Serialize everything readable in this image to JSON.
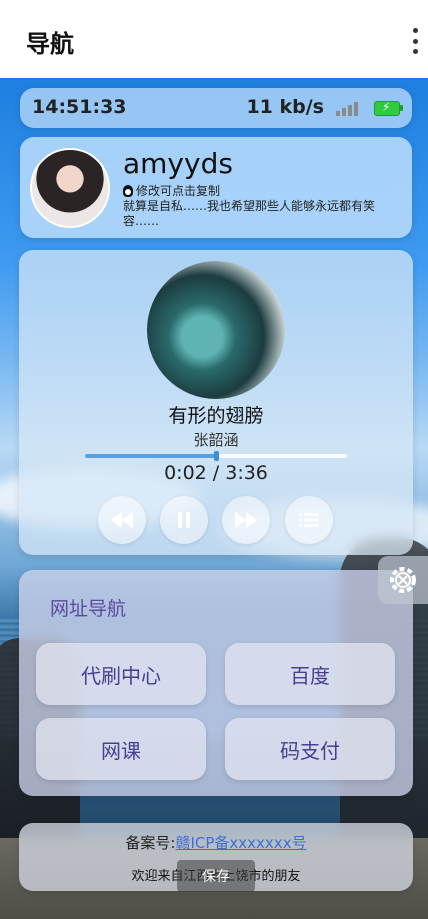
{
  "appbar": {
    "title": "导航",
    "more_icon": "more-vertical-icon"
  },
  "status": {
    "time": "14:51:33",
    "speed": "11 kb/s",
    "battery_color": "#2ecc40"
  },
  "profile": {
    "name": "amyyds",
    "qq_hint": "修改可点击复制",
    "bio": "就算是自私……我也希望那些人能够永远都有笑容……"
  },
  "music": {
    "song": "有形的翅膀",
    "artist": "张韶涵",
    "time_display": "0:02 / 3:36",
    "progress": 0.5,
    "controls": [
      "rewind-icon",
      "pause-icon",
      "fast-forward-icon",
      "playlist-icon"
    ]
  },
  "nav": {
    "heading": "网址导航",
    "buttons": [
      "代刷中心",
      "百度",
      "网课",
      "码支付"
    ]
  },
  "footer": {
    "icp_label": "备案号:",
    "icp_link": "赣ICP备xxxxxxx号",
    "welcome": "欢迎来自江西省上饶市的朋友",
    "save_label": "保存"
  },
  "colors": {
    "accent": "#5b4a9f",
    "link": "#3a6fd8"
  }
}
